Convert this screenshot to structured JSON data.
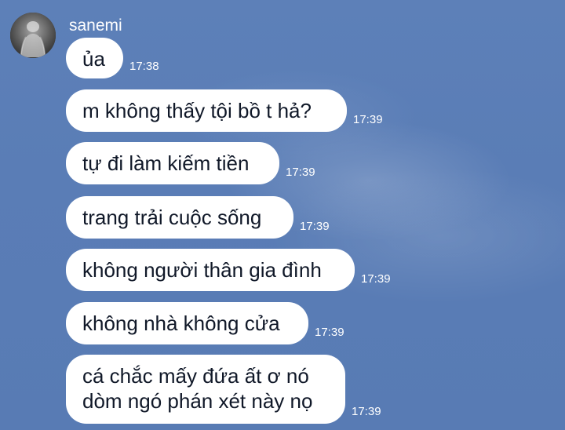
{
  "chat": {
    "sender_name": "sanemi",
    "messages": [
      {
        "text": "ủa",
        "time": "17:38"
      },
      {
        "text": "m không thấy tội bồ t hả?",
        "time": "17:39"
      },
      {
        "text": "tự đi làm kiếm tiền",
        "time": "17:39"
      },
      {
        "text": "trang trải cuộc sống",
        "time": "17:39"
      },
      {
        "text": "không người thân gia đình",
        "time": "17:39"
      },
      {
        "text": "không nhà không cửa",
        "time": "17:39"
      },
      {
        "text": "cá chắc mấy đứa ất ơ nó\ndòm ngó phán xét này nọ",
        "time": "17:39"
      }
    ]
  },
  "theme": {
    "background": "#5a7db6",
    "bubble": "#ffffff",
    "bubble_text": "#101828",
    "meta_text": "#ffffff"
  }
}
